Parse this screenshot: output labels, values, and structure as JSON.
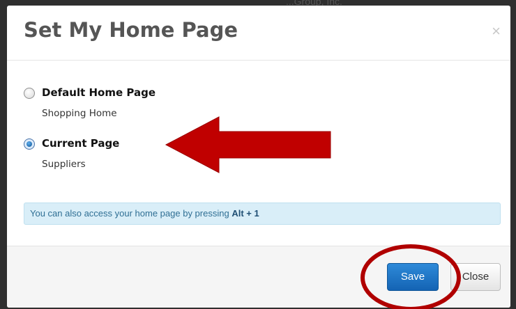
{
  "backdrop": {
    "partial_text": "...Group, Inc."
  },
  "dialog": {
    "title": "Set My Home Page",
    "close_glyph": "×",
    "options": [
      {
        "label": "Default Home Page",
        "sublabel": "Shopping Home",
        "checked": false
      },
      {
        "label": "Current Page",
        "sublabel": "Suppliers",
        "checked": true
      }
    ],
    "info": {
      "prefix": "You can also access your home page by pressing ",
      "shortcut": "Alt + 1"
    },
    "buttons": {
      "save": "Save",
      "close": "Close"
    }
  },
  "annotations": {
    "arrow_color": "#c00000",
    "circle_color": "#b00000",
    "arrow_icon": "left-arrow-annotation",
    "circle_icon": "highlight-circle-annotation"
  }
}
